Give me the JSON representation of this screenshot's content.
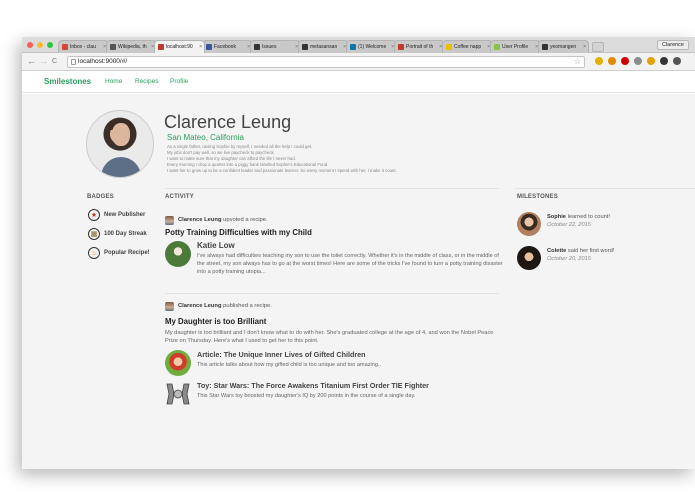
{
  "browser": {
    "tabs": [
      {
        "label": "Inbox - clau",
        "color": "#d44638",
        "active": false
      },
      {
        "label": "Wikipedia, th",
        "color": "#555555",
        "active": false
      },
      {
        "label": "localhost:90",
        "color": "#c0392b",
        "active": true
      },
      {
        "label": "Facebook",
        "color": "#3b5998",
        "active": false
      },
      {
        "label": "Issues",
        "color": "#333333",
        "active": false
      },
      {
        "label": "metasansan",
        "color": "#333333",
        "active": false
      },
      {
        "label": "(1) Welcome",
        "color": "#0e76a8",
        "active": false
      },
      {
        "label": "Portrait of th",
        "color": "#c0392b",
        "active": false
      },
      {
        "label": "Coffee napp",
        "color": "#e6c200",
        "active": false
      },
      {
        "label": "User Profile",
        "color": "#8bc34a",
        "active": false
      },
      {
        "label": "yeomangen",
        "color": "#333333",
        "active": false
      }
    ],
    "tab_close": "×",
    "profile_button": "Clarence",
    "url": "localhost:9000/#/",
    "nav": {
      "back": "←",
      "forward": "→",
      "reload": "C"
    },
    "extensions": [
      "#e0b100",
      "#e08a00",
      "#cc0000",
      "#8c8c8c",
      "#e6a000",
      "#333333",
      "#555555"
    ]
  },
  "app": {
    "brand": "Smilestones",
    "nav": [
      "Home",
      "Recipes",
      "Profile"
    ]
  },
  "profile": {
    "name": "Clarence Leung",
    "location": "San Mateo, California",
    "bio": [
      "As a single father, raising Sophie by myself, I needed all the help I could get.",
      "My jobs don't pay well, so we live paycheck to paycheck.",
      "I want to make sure that my daughter can afford the life I never had.",
      "Every morning I drop a quarter into a piggy bank labelled Sophie's Educational Fund.",
      "I want her to grow up to be a confident leader and passionate learner. So every moment I spend with her, I make it count."
    ]
  },
  "badges": {
    "heading": "BADGES",
    "items": [
      {
        "label": "New Publisher",
        "icon": "star-icon",
        "glyph": "★",
        "color": "#c0392b"
      },
      {
        "label": "100 Day Streak",
        "icon": "calendar-icon",
        "glyph": "▦",
        "color": "#7a5a1a"
      },
      {
        "label": "Popular Recipe!",
        "icon": "flame-icon",
        "glyph": "♨",
        "color": "#e67e22"
      }
    ]
  },
  "activity": {
    "heading": "ACTIVITY",
    "items": [
      {
        "actor": "Clarence Leung",
        "verb": "upvoted a recipe.",
        "title": "Potty Training Difficulties with my Child",
        "author": "Katie Low",
        "text": "I've always had difficulties teaching my son to use the toilet correctly.  Whether it's in the middle of class, or in the middle of the street, my son always has to go at the worst times!  Here are some of the tricks I've found to turn a potty training disaster into a potty training utopia..."
      },
      {
        "actor": "Clarence Leung",
        "verb": "published a recipe.",
        "title": "My Daughter is too Brilliant",
        "text": "My daughter is too brilliant and I don't know what to do with her. She's graduated college at the age of 4, and won the Nobel Peace Prize on Thursday.  Here's what I used to get her to this point.",
        "resources": [
          {
            "title": "Article: The Unique Inner Lives of Gifted Children",
            "text": "This article talks about how my gifted child is too unique and too amazing..",
            "icon": "article-thumbnail"
          },
          {
            "title": "Toy: Star Wars: The Force Awakens Titanium First Order TIE Fighter",
            "text": "This Star Wars toy boosted my daughter's IQ by 200 points in the course of a single day.",
            "icon": "tie-fighter-thumbnail"
          }
        ]
      }
    ]
  },
  "milestones": {
    "heading": "MILESTONES",
    "items": [
      {
        "name": "Sophie",
        "text": "learned to count!",
        "date": "October 22, 2015"
      },
      {
        "name": "Colette",
        "text": "said her first word!",
        "date": "October 20, 2015"
      }
    ]
  }
}
